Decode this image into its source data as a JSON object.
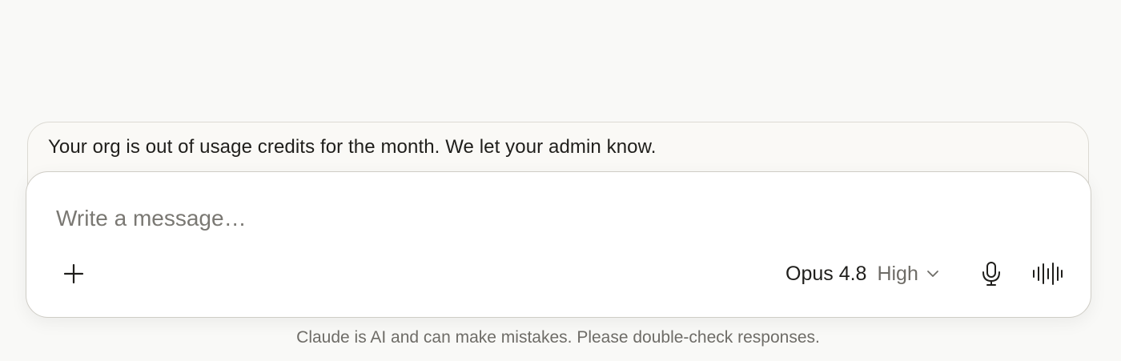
{
  "notice": {
    "text": "Your org is out of usage credits for the month. We let your admin know."
  },
  "composer": {
    "placeholder": "Write a message…",
    "value": "",
    "add_icon": "plus-icon",
    "model": {
      "name": "Opus 4.8",
      "effort": "High",
      "icon": "chevron-down-icon"
    },
    "mic_icon": "microphone-icon",
    "voice_icon": "voice-waveform-icon"
  },
  "footer": {
    "disclaimer": "Claude is AI and can make mistakes. Please double-check responses."
  },
  "colors": {
    "background": "#f9f9f7",
    "card": "#ffffff",
    "text_primary": "#1f1e1b",
    "text_muted": "#6e6c67"
  }
}
